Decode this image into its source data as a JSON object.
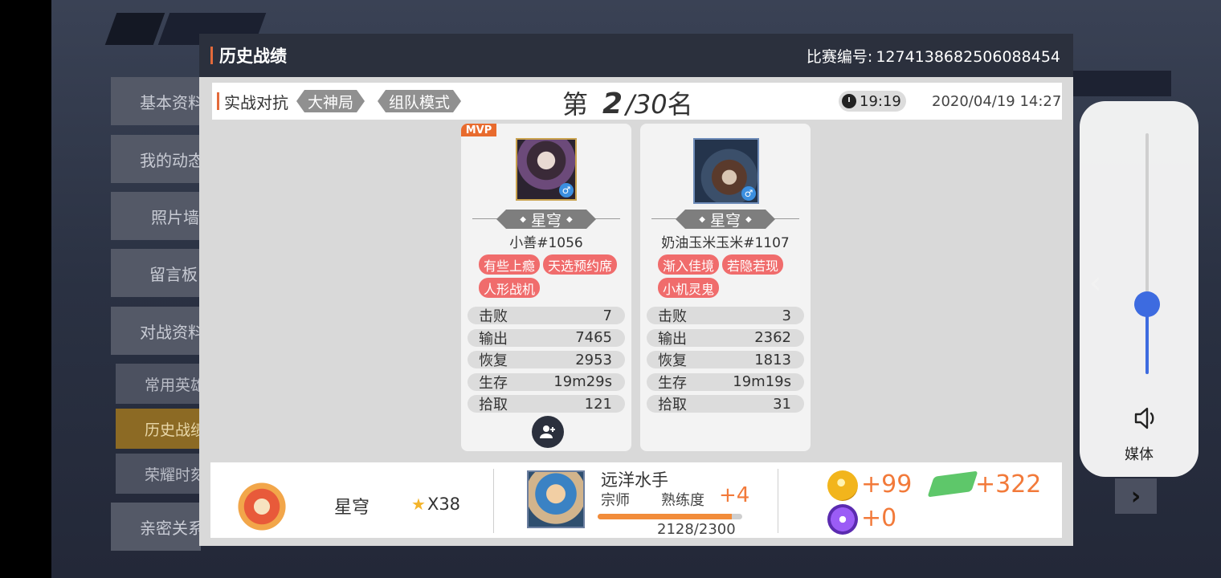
{
  "background": {
    "sidebar_items": [
      "基本资料",
      "我的动态",
      "照片墙",
      "留言板",
      "对战资料"
    ],
    "sidebar_subitems": [
      "常用英雄",
      "历史战绩",
      "荣耀时刻"
    ],
    "sidebar_last": "亲密关系",
    "next_arrow": "›"
  },
  "dialog": {
    "title": "历史战绩",
    "match_id_label": "比赛编号:",
    "match_id": "1274138682506088454"
  },
  "match_info": {
    "mode": "实战对抗",
    "tags": [
      "大神局",
      "组队模式"
    ],
    "rank_prefix": "第",
    "rank": "2",
    "rank_total": "/30",
    "rank_suffix": "名",
    "duration": "19:19",
    "datetime": "2020/04/19 14:27"
  },
  "players": [
    {
      "mvp": "MVP",
      "gender": "♂",
      "tier": "星穹",
      "name": "小善#1056",
      "tags": [
        "有些上瘾",
        "天选预约席",
        "人形战机"
      ],
      "stats": [
        {
          "label": "击败",
          "value": "7"
        },
        {
          "label": "输出",
          "value": "7465"
        },
        {
          "label": "恢复",
          "value": "2953"
        },
        {
          "label": "生存",
          "value": "19m29s"
        },
        {
          "label": "拾取",
          "value": "121"
        }
      ],
      "add_friend_icon": "add-user-icon"
    },
    {
      "gender": "♂",
      "tier": "星穹",
      "name": "奶油玉米玉米#1107",
      "tags": [
        "渐入佳境",
        "若隐若现",
        "小机灵鬼"
      ],
      "stats": [
        {
          "label": "击败",
          "value": "3"
        },
        {
          "label": "输出",
          "value": "2362"
        },
        {
          "label": "恢复",
          "value": "1813"
        },
        {
          "label": "生存",
          "value": "19m19s"
        },
        {
          "label": "拾取",
          "value": "31"
        }
      ]
    }
  ],
  "summary": {
    "rank_name": "星穹",
    "stars": "X38",
    "hero_name": "远洋水手",
    "hero_rank": "宗师",
    "proficiency_label": "熟练度",
    "proficiency_gain": "+4",
    "proficiency_value": "2128/2300",
    "proficiency_fraction": 0.925,
    "gold_gain": "+99",
    "ticket_gain": "+322",
    "crystal_gain": "+0"
  },
  "volume": {
    "label": "媒体",
    "level_fraction": 0.29,
    "collapse_icon": "‹",
    "speaker_icon": "speaker-icon"
  }
}
